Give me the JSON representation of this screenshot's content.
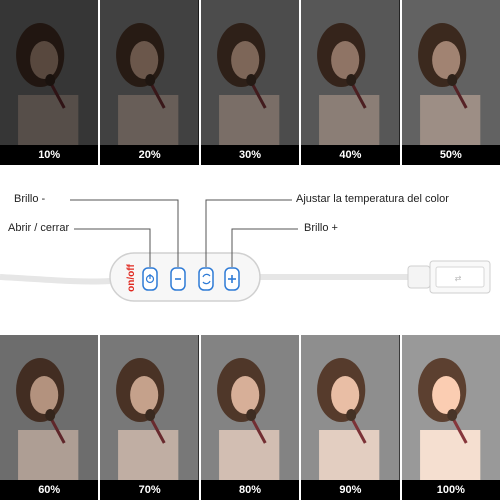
{
  "top_row": [
    {
      "caption": "10%",
      "brightness": 0.1
    },
    {
      "caption": "20%",
      "brightness": 0.2
    },
    {
      "caption": "30%",
      "brightness": 0.3
    },
    {
      "caption": "40%",
      "brightness": 0.4
    },
    {
      "caption": "50%",
      "brightness": 0.5
    }
  ],
  "bottom_row": [
    {
      "caption": "60%",
      "brightness": 0.6
    },
    {
      "caption": "70%",
      "brightness": 0.7
    },
    {
      "caption": "80%",
      "brightness": 0.8
    },
    {
      "caption": "90%",
      "brightness": 0.9
    },
    {
      "caption": "100%",
      "brightness": 1.0
    }
  ],
  "controller": {
    "brand_text": "on/off",
    "labels": {
      "brightness_down": "Brillo -",
      "open_close": "Abrir / cerrar",
      "color_temperature": "Ajustar la temperatura del color",
      "brightness_up": "Brillo +"
    },
    "buttons": [
      {
        "name": "power",
        "icon": "power-icon"
      },
      {
        "name": "brightness-down",
        "icon": "minus-icon"
      },
      {
        "name": "color-temperature",
        "icon": "cycle-icon"
      },
      {
        "name": "brightness-up",
        "icon": "plus-icon"
      }
    ],
    "accent_color": "#2f7bd6",
    "brand_color": "#e0281f"
  }
}
